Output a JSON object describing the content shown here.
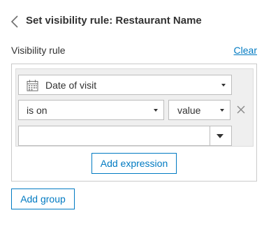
{
  "header": {
    "back_icon": "chevron-left-icon",
    "title": "Set visibility rule: Restaurant Name"
  },
  "rule": {
    "section_label": "Visibility rule",
    "clear_label": "Clear",
    "accent_color": "#007ac2",
    "expression": {
      "field_icon": "calendar-icon",
      "field_value": "Date of visit",
      "operator_value": "is on",
      "value_type": "value",
      "remove_icon": "close-icon",
      "input_value": "",
      "input_dropdown_icon": "caret-down-icon"
    },
    "add_expression_label": "Add expression"
  },
  "add_group_label": "Add group"
}
